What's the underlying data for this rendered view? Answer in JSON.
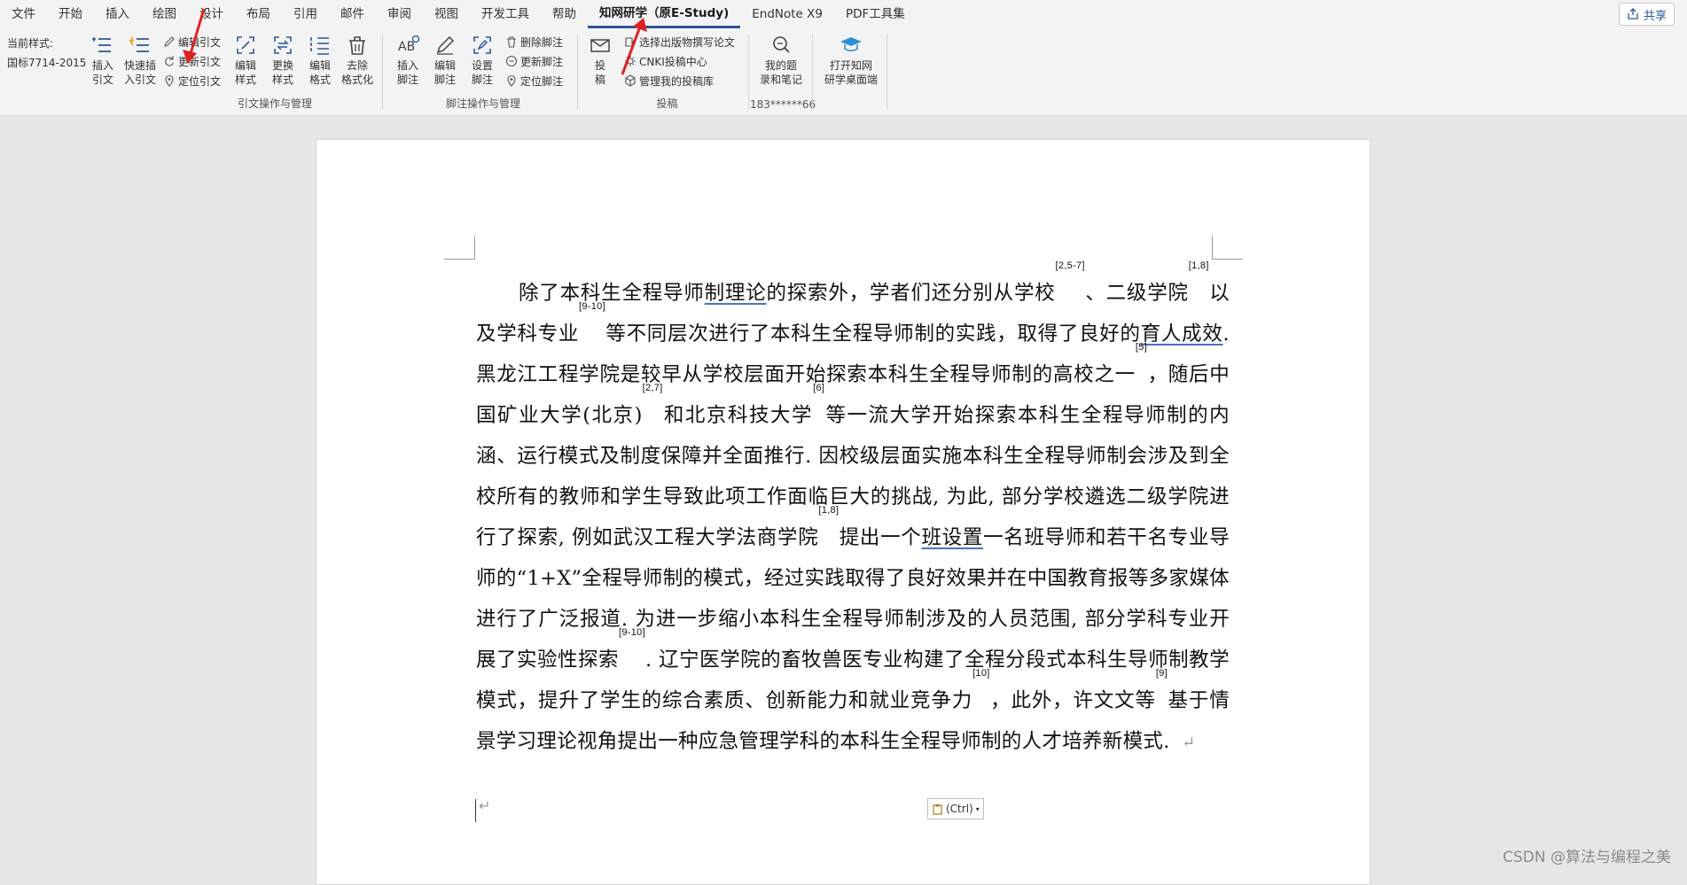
{
  "tabs": [
    "文件",
    "开始",
    "插入",
    "绘图",
    "设计",
    "布局",
    "引用",
    "邮件",
    "审阅",
    "视图",
    "开发工具",
    "帮助",
    "知网研学（原E-Study)",
    "EndNote X9",
    "PDF工具集"
  ],
  "active_tab_index": 12,
  "share_label": "共享",
  "ribbon": {
    "current_style_label": "当前样式:",
    "current_style_value": "国标7714-2015",
    "groups": {
      "citation": {
        "label": "引文操作与管理",
        "insert_citation": [
          "插入",
          "引文"
        ],
        "quick_insert": [
          "快速插",
          "入引文"
        ],
        "edit_citation": "编辑引文",
        "update_citation": "更新引文",
        "locate_citation": "定位引文",
        "edit_style": [
          "编辑",
          "样式"
        ],
        "change_style": [
          "更换",
          "样式"
        ],
        "edit_format": [
          "编辑",
          "格式"
        ],
        "remove_format": [
          "去除",
          "格式化"
        ]
      },
      "footnote": {
        "label": "脚注操作与管理",
        "insert_footnote": [
          "插入",
          "脚注"
        ],
        "edit_footnote": [
          "编辑",
          "脚注"
        ],
        "set_footnote": [
          "设置",
          "脚注"
        ],
        "delete_footnote": "删除脚注",
        "update_footnote": "更新脚注",
        "locate_footnote": "定位脚注"
      },
      "submission": {
        "label": "投稿",
        "submit": [
          "投",
          "稿"
        ],
        "select_publication": "选择出版物撰写论文",
        "cnki_center": "CNKI投稿中心",
        "manage_library": "管理我的投稿库"
      },
      "account": {
        "label": "183******66",
        "my_notes": [
          "我的题",
          "录和笔记"
        ]
      },
      "desktop": {
        "open_desktop": [
          "打开知网",
          "研学桌面端"
        ]
      }
    }
  },
  "document": {
    "segments": [
      {
        "t": "除了本科生全程导师"
      },
      {
        "t": "制理论",
        "u": true
      },
      {
        "t": "的探索外，学者们还分别从学校"
      },
      {
        "sup": "[2,5-7]"
      },
      {
        "t": "、二级学院"
      },
      {
        "sup": "[1,8]"
      },
      {
        "t": "以及学科专业"
      },
      {
        "sup": "[9-10]"
      },
      {
        "t": "等不同层次进行了本科生全程导师制的实践，取得了良好的"
      },
      {
        "t": "育人成效",
        "u": true
      },
      {
        "t": ". 黑龙江工程学院是较早从学校层面开始探索本科生全程导师制的高校之一"
      },
      {
        "sup": "[5]"
      },
      {
        "t": "，随后中国矿业大学(北京)"
      },
      {
        "sup": "[2,7]"
      },
      {
        "t": "和北京科技大学"
      },
      {
        "sup": "[6]"
      },
      {
        "t": "等一流大学开始探索本科生全程导师制的内涵、运行模式及制度保障并全面推行. 因校级层面实施本科生全程导师制会涉及到全校所有的教师和学生导致此项工作面临巨大的挑战, 为此, 部分学校遴选二级学院进行了探索, 例如武汉工程大学法商学院"
      },
      {
        "sup": "[1,8]"
      },
      {
        "t": "提出一个"
      },
      {
        "t": "班设置",
        "u": true
      },
      {
        "t": "一名班导师和若干名专业导师的“1+X”全程导师制的模式，经过实践取得了良好效果并在中国教育报等多家媒体进行了广泛报道. 为进一步缩小本科生全程导师制涉及的人员范围, 部分学科专业开展了实验性探索"
      },
      {
        "sup": "[9-10]"
      },
      {
        "t": ". 辽宁医学院的畜牧兽医专业构建了全程分段式本科生导师制教学模式，提升了学生的综合素质、创新能力和就业竞争力"
      },
      {
        "sup": "[10]"
      },
      {
        "t": "，此外，许文文等"
      },
      {
        "sup": "[9]"
      },
      {
        "t": "基于情景学习理论视角提出一种应急管理学科的本科生全程导师制的人才培养新模式. "
      }
    ],
    "paragraph_mark": "↵",
    "paste_options_label": "(Ctrl)"
  },
  "watermark": "CSDN @算法与编程之美",
  "colors": {
    "accent": "#2b579a",
    "annotation_arrow": "#e02020",
    "underline": "#4a72c7"
  }
}
